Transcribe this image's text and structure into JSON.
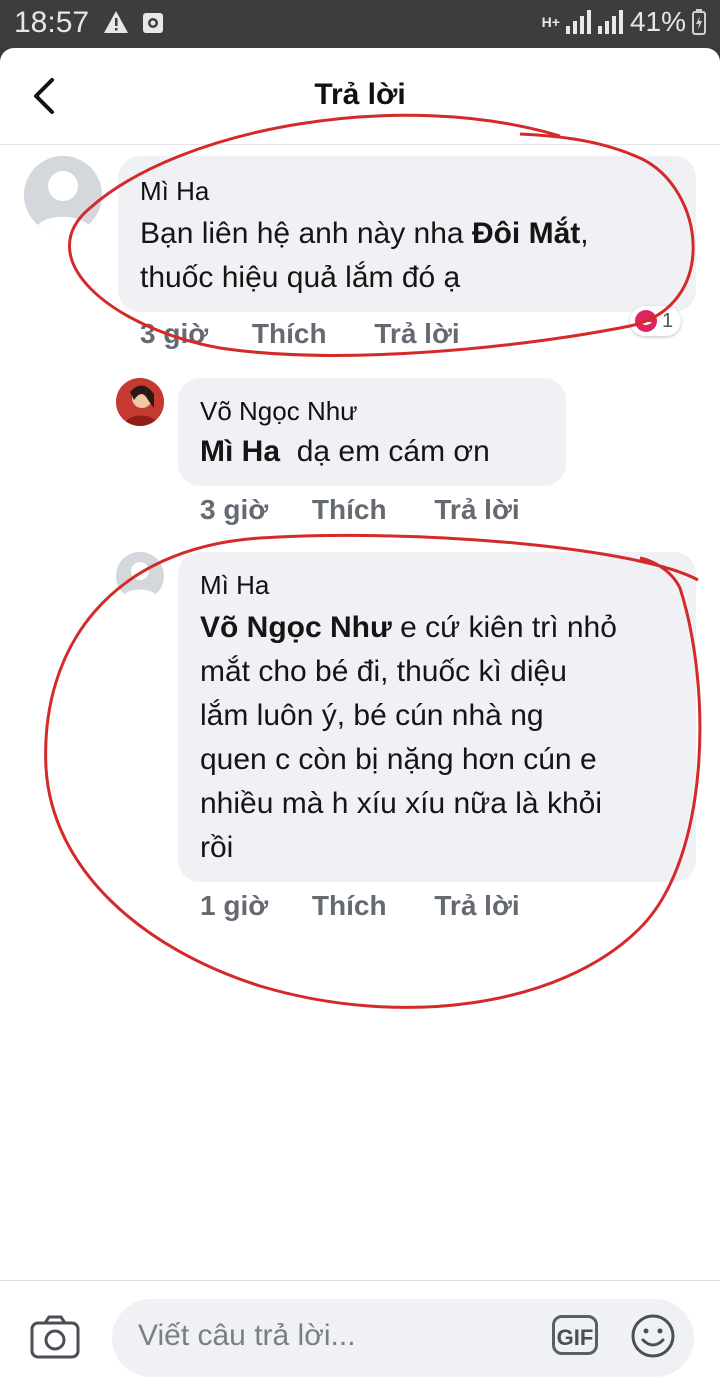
{
  "status_bar": {
    "time": "18:57",
    "network": "H+",
    "battery": "41%"
  },
  "header": {
    "title": "Trả lời"
  },
  "comments": [
    {
      "author": "Mì Ha",
      "text_lines": [
        "Bạn liên hệ anh này nha ",
        "Đôi Mắt",
        ",",
        "thuốc hiệu quả lắm đó ạ"
      ],
      "time": "3 giờ",
      "like": "Thích",
      "reply": "Trả lời",
      "reaction_count": "1"
    },
    {
      "author": "Võ Ngọc Như",
      "mention": "Mì Ha",
      "text": "dạ em cám ơn",
      "time": "3 giờ",
      "like": "Thích",
      "reply": "Trả lời"
    },
    {
      "author": "Mì Ha",
      "mention": "Võ Ngọc Như",
      "text_lines": [
        "e cứ kiên trì nhỏ",
        "mắt cho bé đi, thuốc kì diệu",
        "lắm luôn ý, bé cún nhà ng",
        "quen c còn bị nặng hơn cún e",
        "nhiều mà h xíu xíu nữa là khỏi",
        "rồi"
      ],
      "time": "1 giờ",
      "like": "Thích",
      "reply": "Trả lời"
    }
  ],
  "composer": {
    "placeholder": "Viết câu trả lời...",
    "gif_label": "GIF"
  },
  "colors": {
    "annotation": "#d42a2a",
    "bubble": "#f0f1f5",
    "reaction": "#e0245e"
  }
}
